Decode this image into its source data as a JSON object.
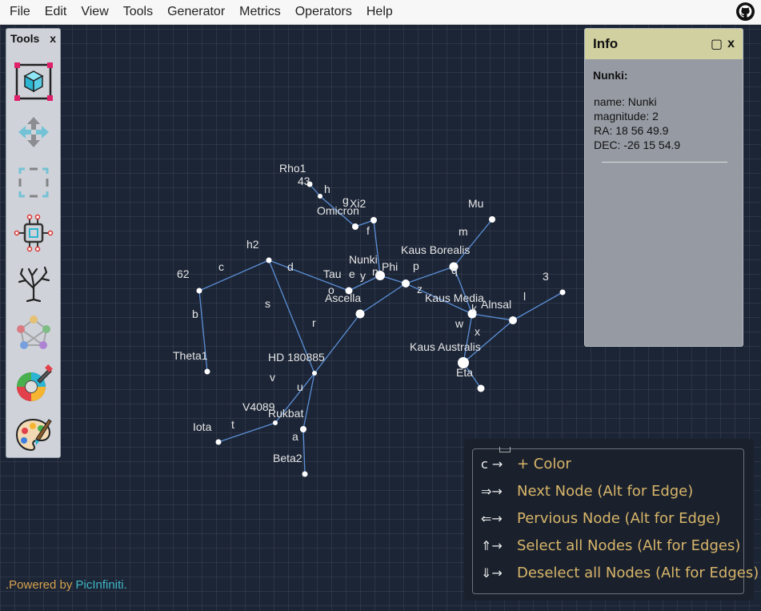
{
  "menu": [
    "File",
    "Edit",
    "View",
    "Tools",
    "Generator",
    "Metrics",
    "Operators",
    "Help"
  ],
  "github_icon": "github-icon",
  "tools": {
    "title": "Tools",
    "close": "x",
    "items": [
      {
        "name": "select-cube-tool",
        "icon": "cube-select-icon"
      },
      {
        "name": "move-tool",
        "icon": "move-arrows-icon"
      },
      {
        "name": "marquee-tool",
        "icon": "marquee-icon"
      },
      {
        "name": "chip-tool",
        "icon": "chip-icon"
      },
      {
        "name": "tree-tool",
        "icon": "tree-icon"
      },
      {
        "name": "graph-tool",
        "icon": "colored-graph-icon"
      },
      {
        "name": "color-picker-tool",
        "icon": "color-dropper-icon"
      },
      {
        "name": "palette-tool",
        "icon": "palette-icon"
      }
    ]
  },
  "info": {
    "title": "Info",
    "maximize": "▢",
    "close": "x",
    "node_title": "Nunki:",
    "lines": [
      "name: Nunki",
      "magnitude: 2",
      "RA: 18 56 49.9",
      "DEC: -26 15 54.9"
    ]
  },
  "graph": {
    "node_labels": [
      "Rho1",
      "43",
      "Xi2",
      "Omicron",
      "Mu",
      "Kaus Borealis",
      "Nunki",
      "Phi",
      "h2",
      "62",
      "Tau",
      "Ascella",
      "Kaus Media",
      "Alnsal",
      "3",
      "Theta1",
      "HD 180885",
      "Kaus Australis",
      "Eta",
      "V4089",
      "Rukbat",
      "Iota",
      "Beta2"
    ],
    "edge_labels": [
      "h",
      "g",
      "f",
      "m",
      "c",
      "d",
      "e",
      "y",
      "n",
      "p",
      "q",
      "o",
      "z",
      "s",
      "b",
      "r",
      "k",
      "l",
      "w",
      "x",
      "v",
      "u",
      "t",
      "a"
    ]
  },
  "shortcuts": [
    {
      "key": "c →",
      "desc": "+ Color"
    },
    {
      "key": "⇒→",
      "desc": "Next Node (Alt for Edge)"
    },
    {
      "key": "⇐→",
      "desc": "Pervious Node (Alt for Edge)"
    },
    {
      "key": "⇑→",
      "desc": "Select all Nodes (Alt for Edges)"
    },
    {
      "key": "⇓→",
      "desc": "Deselect all Nodes (Alt for Edges)"
    }
  ],
  "footer": {
    "prefix": ".Powered by ",
    "brand": "PicInfiniti."
  },
  "colors": {
    "edge": "#5b8fd6",
    "node": "#ffffff",
    "accent": "#d8b56a",
    "brand": "#3fb7c6"
  }
}
